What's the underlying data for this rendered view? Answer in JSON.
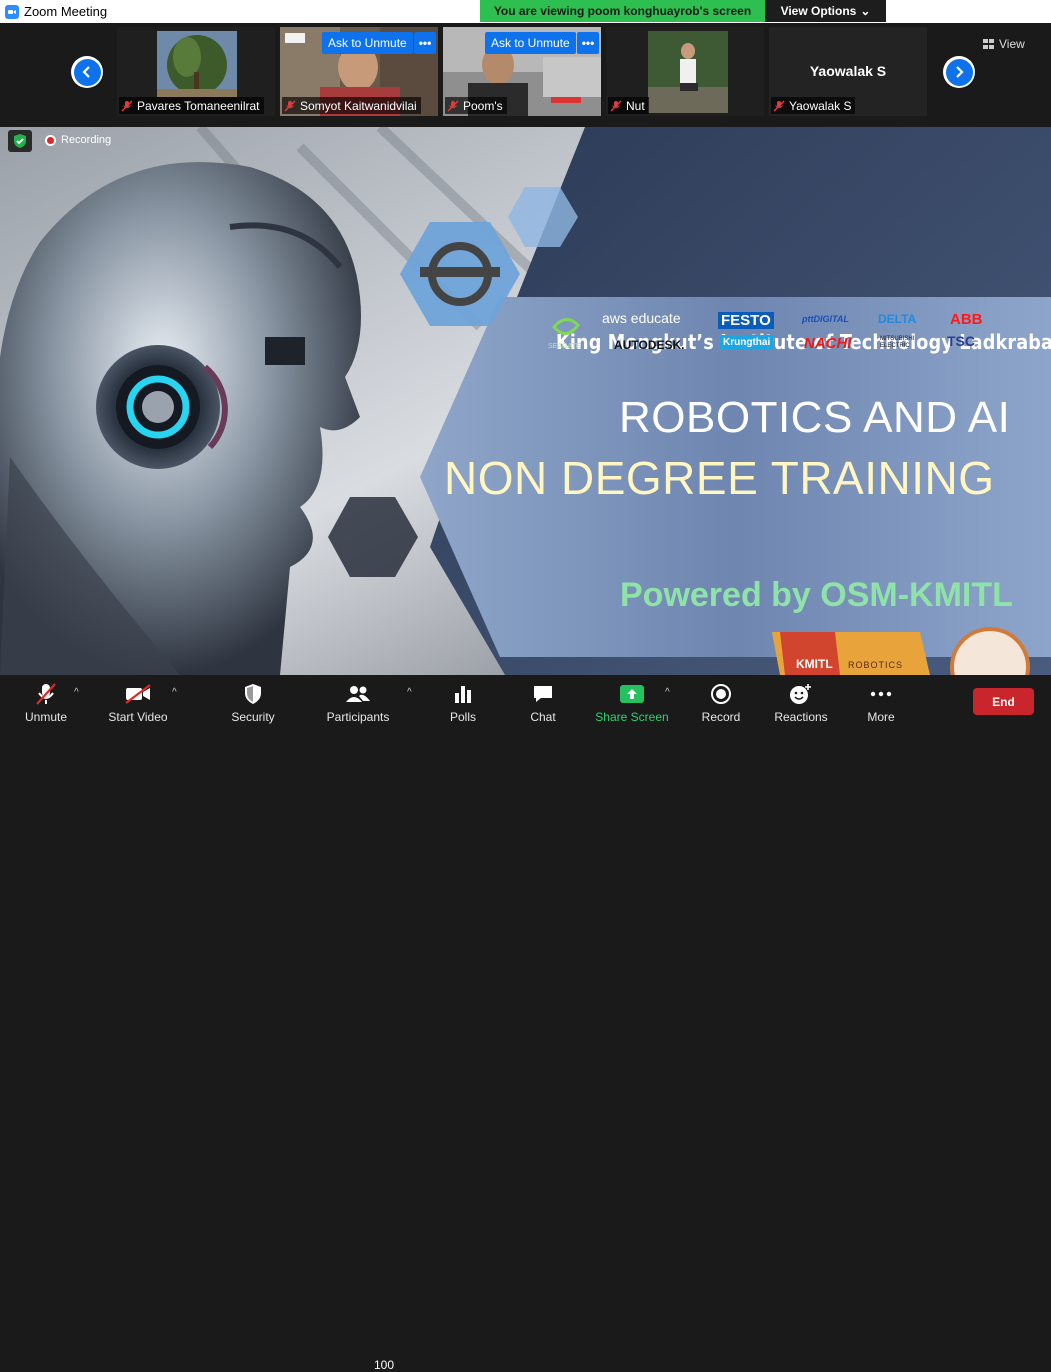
{
  "window": {
    "title": "Zoom Meeting"
  },
  "banner": {
    "viewing": "You are viewing poom konghuayrob's screen",
    "view_options": "View Options"
  },
  "gallery": {
    "view_label": "View",
    "ask_to_unmute": "Ask to Unmute",
    "more": "•••",
    "tiles": [
      {
        "name": "Pavares Tomaneenilrat"
      },
      {
        "name": "Somyot Kaitwanidvilai"
      },
      {
        "name": "Poom's"
      },
      {
        "name": "Nut"
      },
      {
        "name": "Yaowalak S",
        "display_name": "Yaowalak S"
      }
    ]
  },
  "status": {
    "recording": "Recording"
  },
  "slide": {
    "institute": "King Mongkut’s Institute of Technology Ladkrabang",
    "title_line1": "ROBOTICS AND AI",
    "title_line2": "NON DEGREE TRAINING",
    "powered": "Powered by OSM-KMITL",
    "logos": [
      "SEAGATE",
      "aws educate",
      "FESTO",
      "pttDIGITAL",
      "DELTA",
      "ABB",
      "AUTODESK.",
      "Krungthai",
      "NACHI",
      "MITSUBISHI ELECTRIC",
      "TSC",
      "KMITL",
      "ROBOTICS"
    ]
  },
  "toolbar": {
    "unmute": "Unmute",
    "start_video": "Start Video",
    "security": "Security",
    "participants": "Participants",
    "participants_count": "100",
    "polls": "Polls",
    "chat": "Chat",
    "share_screen": "Share Screen",
    "record": "Record",
    "reactions": "Reactions",
    "more": "More",
    "end": "End"
  },
  "colors": {
    "accent": "#0e72ed",
    "share_green": "#2dd36f",
    "banner_green": "#2dbf4f",
    "end_red": "#c9252c"
  }
}
